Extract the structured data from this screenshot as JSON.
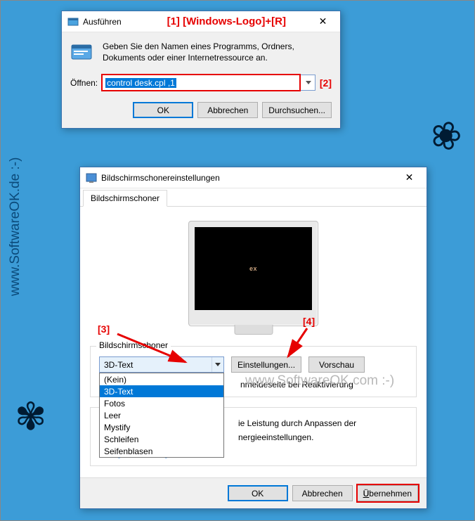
{
  "watermark_vertical": "www.SoftwareOK.de :-)",
  "watermark_horizontal": "www.SoftwareOK.com :-)",
  "annotations": {
    "a1": "[1]  [Windows-Logo]+[R]",
    "a2": "[2]",
    "a3": "[3]",
    "a4": "[4]"
  },
  "run": {
    "title": "Ausführen",
    "description": "Geben Sie den Namen eines Programms, Ordners, Dokuments oder einer Internetressource an.",
    "open_label": "Öffnen:",
    "command": "control desk.cpl ,1",
    "ok": "OK",
    "cancel": "Abbrechen",
    "browse": "Durchsuchen..."
  },
  "settings": {
    "title": "Bildschirmschonereinstellungen",
    "tab": "Bildschirmschoner",
    "preview_text": "ex",
    "group_label": "Bildschirmschoner",
    "selected": "3D-Text",
    "options": [
      "(Kein)",
      "3D-Text",
      "Fotos",
      "Leer",
      "Mystify",
      "Schleifen",
      "Seifenblasen"
    ],
    "settings_btn": "Einstellungen...",
    "preview_btn": "Vorschau",
    "checkbox_trail": "nmeldeseite bei Reaktivierung",
    "energy_line1": "ie Leistung durch Anpassen der",
    "energy_line2": "nergieeinstellungen.",
    "link": "Energieeinstellungen ändern",
    "ok": "OK",
    "cancel": "Abbrechen",
    "apply": "Übernehmen"
  }
}
